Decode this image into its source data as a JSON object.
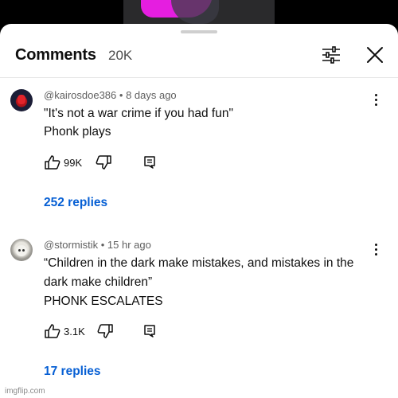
{
  "header": {
    "title": "Comments",
    "count": "20K"
  },
  "icons": {
    "filter": "filter-sliders-icon",
    "close": "close-icon",
    "like": "thumbs-up-icon",
    "dislike": "thumbs-down-icon",
    "reply": "reply-comment-icon",
    "more": "more-vert-icon"
  },
  "comments": [
    {
      "author": "@kairosdoe386",
      "time": "8 days ago",
      "lines": [
        "\"It's not a war crime if you had fun\"",
        "Phonk plays"
      ],
      "likes": "99K",
      "replies": "252 replies"
    },
    {
      "author": "@stormistik",
      "time": "15 hr ago",
      "lines": [
        "“Children in the dark make mistakes, and mistakes in the",
        "dark make children”",
        "PHONK ESCALATES"
      ],
      "likes": "3.1K",
      "replies": "17 replies"
    }
  ],
  "watermark": "imgflip.com",
  "colors": {
    "link": "#065fd4",
    "meta": "#606060",
    "sheet": "#ffffff",
    "backdrop": "#000000"
  }
}
